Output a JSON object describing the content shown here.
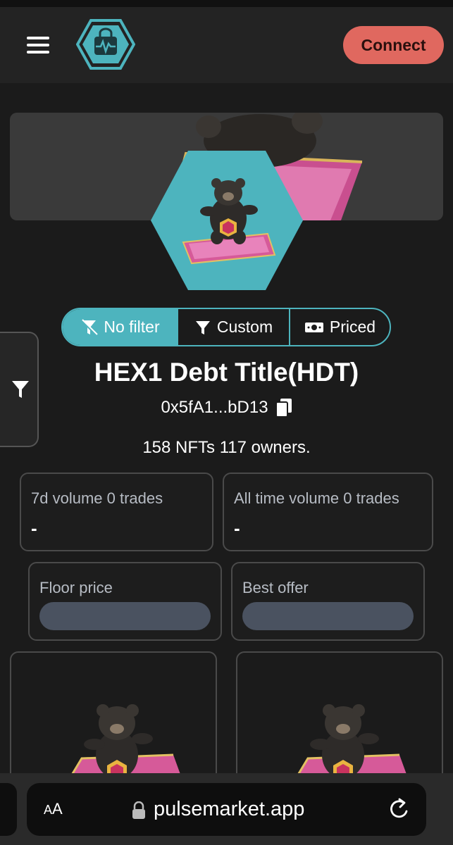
{
  "header": {
    "menu_icon": "hamburger-menu-icon",
    "logo_icon": "shopping-bag-pulse-logo",
    "connect_label": "Connect",
    "colors": {
      "accent": "#4db4be",
      "connect": "#e0685f",
      "background": "#1b1b1b"
    }
  },
  "filters": {
    "no_filter_label": "No filter",
    "custom_label": "Custom",
    "priced_label": "Priced",
    "active": "No filter"
  },
  "collection": {
    "title": "HEX1 Debt Title(HDT)",
    "address": "0x5fA1...bD13",
    "stats": "158 NFTs 117 owners."
  },
  "metrics": {
    "volume_7d_label": "7d volume 0 trades",
    "volume_7d_value": "-",
    "volume_all_label": "All time volume 0 trades",
    "volume_all_value": "-",
    "floor_label": "Floor price",
    "best_offer_label": "Best offer"
  },
  "browser": {
    "aa_small": "A",
    "aa_large": "A",
    "url": "pulsemarket.app"
  }
}
